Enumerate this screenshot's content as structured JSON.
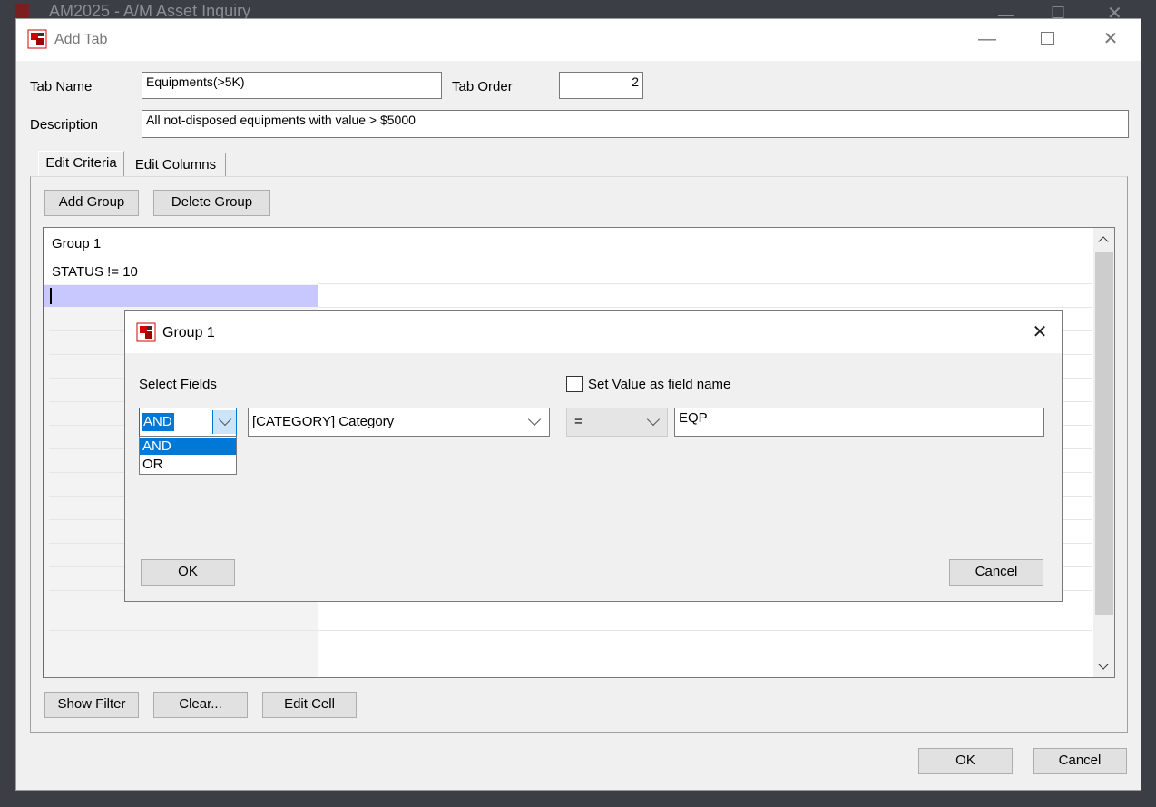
{
  "background_window": {
    "title": "AM2025 - A/M Asset Inquiry"
  },
  "main_window": {
    "title": "Add Tab",
    "tab_name_label": "Tab Name",
    "tab_name_value": "Equipments(>5K)",
    "tab_order_label": "Tab Order",
    "tab_order_value": "2",
    "description_label": "Description",
    "description_value": "All not-disposed equipments with value > $5000",
    "tabs": [
      {
        "label": "Edit Criteria",
        "active": true
      },
      {
        "label": "Edit Columns",
        "active": false
      }
    ],
    "add_group_label": "Add Group",
    "delete_group_label": "Delete Group",
    "grid_rows": [
      "Group 1",
      "STATUS != 10",
      ""
    ],
    "show_filter_label": "Show Filter",
    "clear_label": "Clear...",
    "edit_cell_label": "Edit Cell",
    "ok_label": "OK",
    "cancel_label": "Cancel"
  },
  "group_dialog": {
    "title": "Group 1",
    "select_fields_label": "Select Fields",
    "set_value_checkbox_label": "Set Value as field name",
    "set_value_checked": false,
    "logic_value": "AND",
    "logic_options": [
      "AND",
      "OR"
    ],
    "field_value": "[CATEGORY] Category",
    "operator_value": "=",
    "value_text": "EQP",
    "ok_label": "OK",
    "cancel_label": "Cancel"
  },
  "colors": {
    "selection": "#0078d7",
    "row_highlight": "#c8c8ff",
    "icon_red": "#d40000"
  }
}
